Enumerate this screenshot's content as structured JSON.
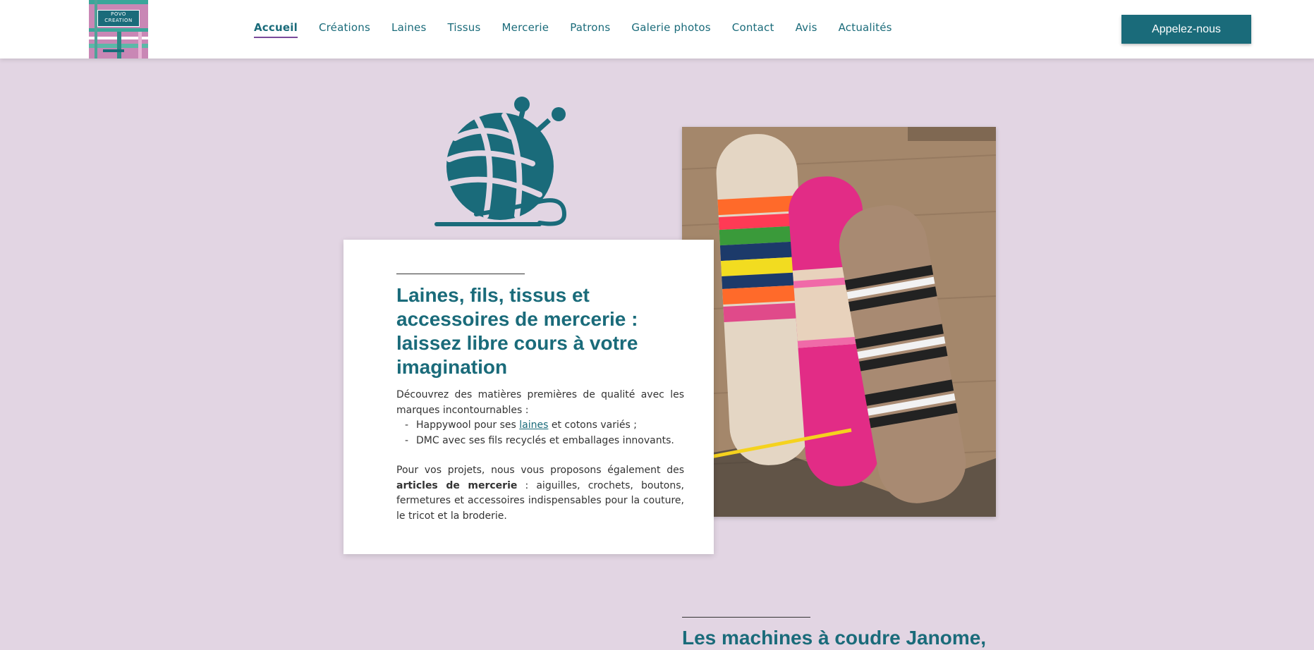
{
  "header": {
    "logo_text": "POVO CREATION",
    "nav": [
      {
        "label": "Accueil",
        "active": true
      },
      {
        "label": "Créations"
      },
      {
        "label": "Laines"
      },
      {
        "label": "Tissus"
      },
      {
        "label": "Mercerie"
      },
      {
        "label": "Patrons"
      },
      {
        "label": "Galerie photos"
      },
      {
        "label": "Contact"
      },
      {
        "label": "Avis"
      },
      {
        "label": "Actualités"
      }
    ],
    "call_button": "Appelez-nous"
  },
  "hero": {
    "icon": "yarn-ball-icon",
    "title": "Laines, fils, tissus et accessoires de mercerie : laissez libre cours à votre imagination",
    "intro": "Découvrez des matières premières de qualité avec les marques incontournables :",
    "list": [
      {
        "before": "Happywool pour ses ",
        "link": "laines",
        "after": " et cotons variés ;"
      },
      {
        "text": "DMC avec ses fils recyclés et emballages innovants."
      }
    ],
    "para2_before": "Pour vos projets, nous vous proposons également des ",
    "para2_bold": "articles de mercerie",
    "para2_after": " : aiguilles, crochets, boutons, fermetures et accessoires indispensables pour la couture, le tricot et la broderie."
  },
  "section2": {
    "title": "Les machines à coudre Janome,"
  },
  "colors": {
    "accent": "#1a6b7a",
    "background": "#e2d5e3",
    "active_underline": "#7a4a9a"
  }
}
